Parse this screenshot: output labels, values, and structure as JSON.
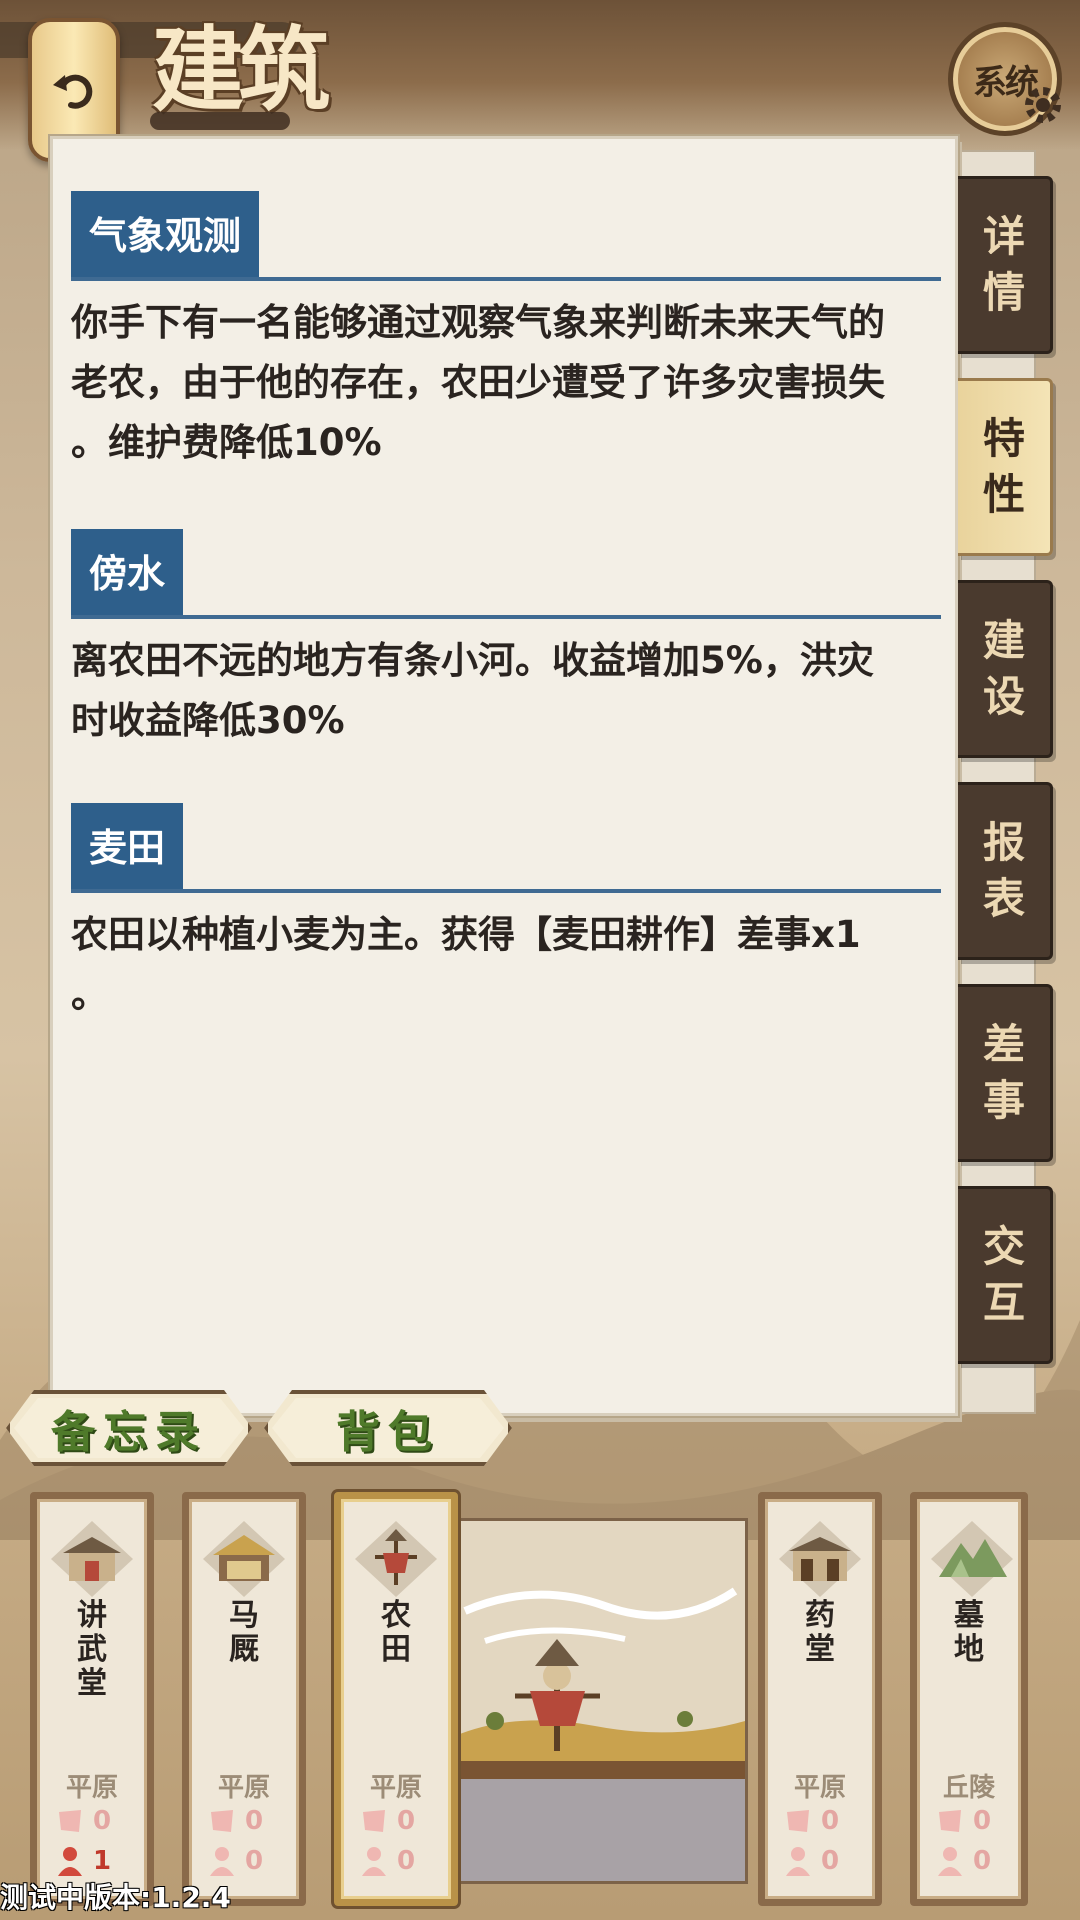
{
  "header": {
    "title": "建筑",
    "system_label": "系统"
  },
  "sections": [
    {
      "tag": "气象观测",
      "body": "你手下有一名能够通过观察气象来判断未来天气的\n老农，由于他的存在，农田少遭受了许多灾害损失\n。维护费降低10%"
    },
    {
      "tag": "傍水",
      "body": "离农田不远的地方有条小河。收益增加5%，洪灾\n时收益降低30%"
    },
    {
      "tag": "麦田",
      "body": "农田以种植小麦为主。获得【麦田耕作】差事x1\n。"
    }
  ],
  "tabs": [
    {
      "label_1": "详",
      "label_2": "情",
      "active": false
    },
    {
      "label_1": "特",
      "label_2": "性",
      "active": true
    },
    {
      "label_1": "建",
      "label_2": "设",
      "active": false
    },
    {
      "label_1": "报",
      "label_2": "表",
      "active": false
    },
    {
      "label_1": "差",
      "label_2": "事",
      "active": false
    },
    {
      "label_1": "交",
      "label_2": "互",
      "active": false
    }
  ],
  "bottom_buttons": {
    "memo": "备忘录",
    "backpack": "背包"
  },
  "buildings": [
    {
      "name": "讲\n武\n堂",
      "terrain": "平原",
      "stat_a": "0",
      "stat_b": "1",
      "icon": "martial-hall-icon"
    },
    {
      "name": "马\n厩",
      "terrain": "平原",
      "stat_a": "0",
      "stat_b": "0",
      "icon": "stable-icon"
    },
    {
      "name": "农\n田",
      "terrain": "平原",
      "stat_a": "0",
      "stat_b": "0",
      "icon": "scarecrow-icon",
      "selected": true
    },
    {
      "name": "药\n堂",
      "terrain": "平原",
      "stat_a": "0",
      "stat_b": "0",
      "icon": "pharmacy-icon"
    },
    {
      "name": "墓\n地",
      "terrain": "丘陵",
      "stat_a": "0",
      "stat_b": "0",
      "icon": "cemetery-icon"
    }
  ],
  "version": "测试中版本:1.2.4",
  "colors": {
    "section_blue": "#2e5f8b",
    "tab_dark": "#4a3a2e",
    "tab_active": "#f4e4b6"
  }
}
